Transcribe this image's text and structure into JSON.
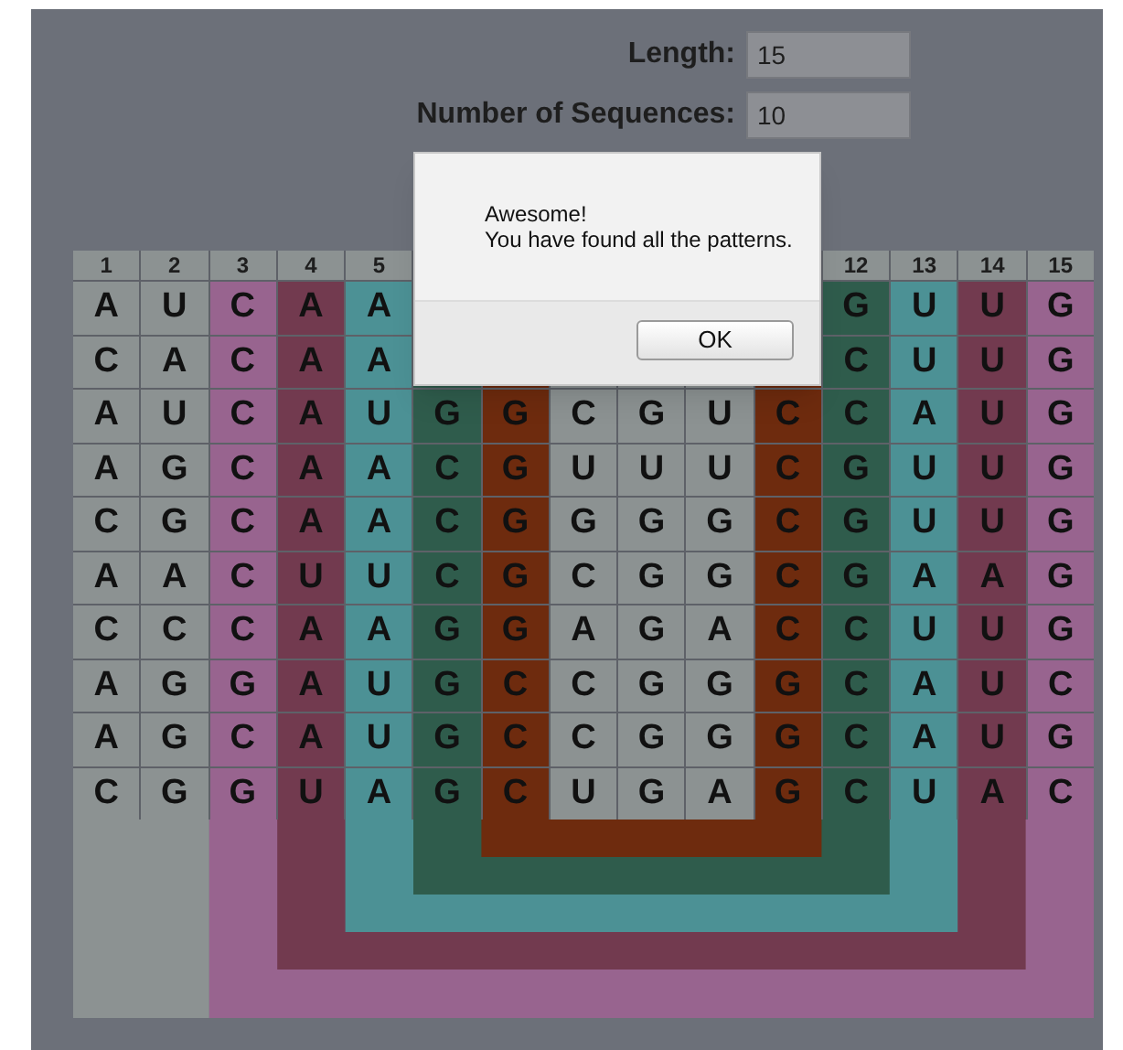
{
  "form": {
    "fields": [
      {
        "label": "Length:",
        "value": "15"
      },
      {
        "label": "Number of Sequences:",
        "value": "10"
      }
    ]
  },
  "grid": {
    "columns": [
      {
        "number": "1",
        "color": "#8c9292",
        "cells": [
          "A",
          "C",
          "A",
          "A",
          "C",
          "A",
          "C",
          "A",
          "A",
          "C"
        ]
      },
      {
        "number": "2",
        "color": "#8c9292",
        "cells": [
          "U",
          "A",
          "U",
          "G",
          "G",
          "A",
          "C",
          "G",
          "G",
          "G"
        ]
      },
      {
        "number": "3",
        "color": "#98648f",
        "cells": [
          "C",
          "C",
          "C",
          "C",
          "C",
          "C",
          "C",
          "G",
          "C",
          "G"
        ]
      },
      {
        "number": "4",
        "color": "#723a4f",
        "cells": [
          "A",
          "A",
          "A",
          "A",
          "A",
          "U",
          "A",
          "A",
          "A",
          "U"
        ]
      },
      {
        "number": "5",
        "color": "#4c9195",
        "cells": [
          "A",
          "A",
          "U",
          "A",
          "A",
          "U",
          "A",
          "U",
          "U",
          "A"
        ]
      },
      {
        "color": "#2f5c4c",
        "cells": [
          null,
          null,
          "G",
          "C",
          "C",
          "C",
          "G",
          "G",
          "G",
          "G"
        ]
      },
      {
        "color": "#6e2b0e",
        "cells": [
          null,
          null,
          "G",
          "G",
          "G",
          "G",
          "G",
          "C",
          "C",
          "C"
        ]
      },
      {
        "color": "#8c9292",
        "cells": [
          null,
          null,
          "C",
          "U",
          "G",
          "C",
          "A",
          "C",
          "C",
          "U"
        ]
      },
      {
        "color": "#8c9292",
        "cells": [
          null,
          null,
          "G",
          "U",
          "G",
          "G",
          "G",
          "G",
          "G",
          "G"
        ]
      },
      {
        "color": "#8c9292",
        "cells": [
          null,
          null,
          "U",
          "U",
          "G",
          "G",
          "A",
          "G",
          "G",
          "A"
        ]
      },
      {
        "color": "#6e2b0e",
        "cells": [
          null,
          null,
          "C",
          "C",
          "C",
          "C",
          "C",
          "G",
          "G",
          "G"
        ]
      },
      {
        "number": "12",
        "color": "#2f5c4c",
        "cells": [
          "G",
          "C",
          "C",
          "G",
          "G",
          "G",
          "C",
          "C",
          "C",
          "C"
        ]
      },
      {
        "number": "13",
        "color": "#4c9195",
        "cells": [
          "U",
          "U",
          "A",
          "U",
          "U",
          "A",
          "U",
          "A",
          "A",
          "U"
        ]
      },
      {
        "number": "14",
        "color": "#723a4f",
        "cells": [
          "U",
          "U",
          "U",
          "U",
          "U",
          "A",
          "U",
          "U",
          "U",
          "A"
        ]
      },
      {
        "number": "15",
        "color": "#98648f",
        "cells": [
          "G",
          "G",
          "G",
          "G",
          "G",
          "G",
          "G",
          "C",
          "G",
          "C"
        ]
      }
    ]
  },
  "dialog": {
    "lines": [
      "Awesome!",
      "You have found all the patterns."
    ],
    "button": "OK"
  }
}
